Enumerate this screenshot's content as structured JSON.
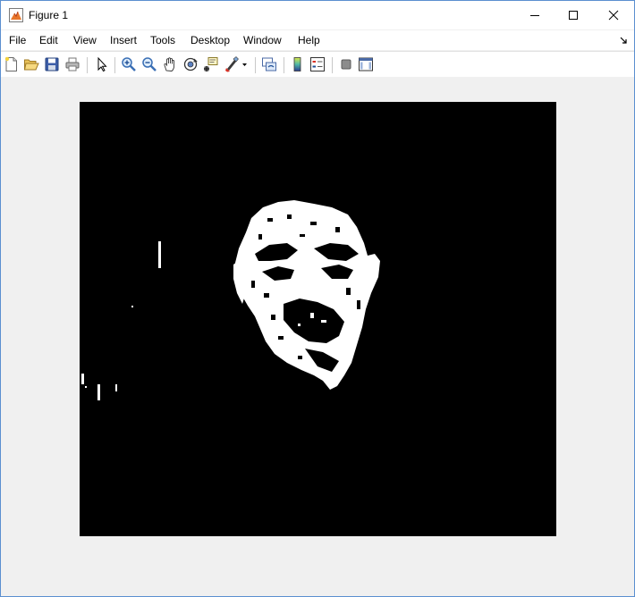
{
  "window": {
    "title": "Figure 1",
    "icon": "matlab-figure-icon",
    "controls": [
      "minimize-icon",
      "maximize-icon",
      "close-icon"
    ]
  },
  "menu": {
    "items": [
      "File",
      "Edit",
      "View",
      "Insert",
      "Tools",
      "Desktop",
      "Window",
      "Help"
    ]
  },
  "toolbar": {
    "buttons": [
      "new-figure-icon",
      "open-file-icon",
      "save-icon",
      "print-icon",
      "edit-plot-arrow-icon",
      "zoom-in-icon",
      "zoom-out-icon",
      "pan-hand-icon",
      "rotate-3d-icon",
      "data-cursor-icon",
      "brush-icon",
      "link-plot-icon",
      "insert-colorbar-icon",
      "insert-legend-icon",
      "hide-plot-tools-icon",
      "show-plot-tools-icon"
    ]
  },
  "figure": {
    "content": "binary thresholded face image (white pixels on black)",
    "background": "#000000",
    "foreground": "#ffffff",
    "figure_bg": "#f0f0f0"
  }
}
